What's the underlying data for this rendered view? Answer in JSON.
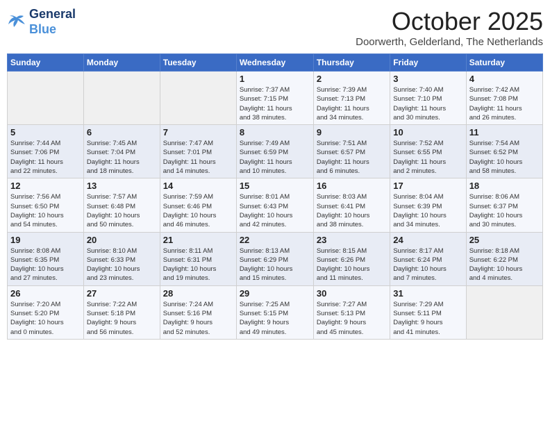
{
  "header": {
    "logo_line1": "General",
    "logo_line2": "Blue",
    "month": "October 2025",
    "location": "Doorwerth, Gelderland, The Netherlands"
  },
  "weekdays": [
    "Sunday",
    "Monday",
    "Tuesday",
    "Wednesday",
    "Thursday",
    "Friday",
    "Saturday"
  ],
  "weeks": [
    [
      {
        "day": "",
        "info": ""
      },
      {
        "day": "",
        "info": ""
      },
      {
        "day": "",
        "info": ""
      },
      {
        "day": "1",
        "info": "Sunrise: 7:37 AM\nSunset: 7:15 PM\nDaylight: 11 hours\nand 38 minutes."
      },
      {
        "day": "2",
        "info": "Sunrise: 7:39 AM\nSunset: 7:13 PM\nDaylight: 11 hours\nand 34 minutes."
      },
      {
        "day": "3",
        "info": "Sunrise: 7:40 AM\nSunset: 7:10 PM\nDaylight: 11 hours\nand 30 minutes."
      },
      {
        "day": "4",
        "info": "Sunrise: 7:42 AM\nSunset: 7:08 PM\nDaylight: 11 hours\nand 26 minutes."
      }
    ],
    [
      {
        "day": "5",
        "info": "Sunrise: 7:44 AM\nSunset: 7:06 PM\nDaylight: 11 hours\nand 22 minutes."
      },
      {
        "day": "6",
        "info": "Sunrise: 7:45 AM\nSunset: 7:04 PM\nDaylight: 11 hours\nand 18 minutes."
      },
      {
        "day": "7",
        "info": "Sunrise: 7:47 AM\nSunset: 7:01 PM\nDaylight: 11 hours\nand 14 minutes."
      },
      {
        "day": "8",
        "info": "Sunrise: 7:49 AM\nSunset: 6:59 PM\nDaylight: 11 hours\nand 10 minutes."
      },
      {
        "day": "9",
        "info": "Sunrise: 7:51 AM\nSunset: 6:57 PM\nDaylight: 11 hours\nand 6 minutes."
      },
      {
        "day": "10",
        "info": "Sunrise: 7:52 AM\nSunset: 6:55 PM\nDaylight: 11 hours\nand 2 minutes."
      },
      {
        "day": "11",
        "info": "Sunrise: 7:54 AM\nSunset: 6:52 PM\nDaylight: 10 hours\nand 58 minutes."
      }
    ],
    [
      {
        "day": "12",
        "info": "Sunrise: 7:56 AM\nSunset: 6:50 PM\nDaylight: 10 hours\nand 54 minutes."
      },
      {
        "day": "13",
        "info": "Sunrise: 7:57 AM\nSunset: 6:48 PM\nDaylight: 10 hours\nand 50 minutes."
      },
      {
        "day": "14",
        "info": "Sunrise: 7:59 AM\nSunset: 6:46 PM\nDaylight: 10 hours\nand 46 minutes."
      },
      {
        "day": "15",
        "info": "Sunrise: 8:01 AM\nSunset: 6:43 PM\nDaylight: 10 hours\nand 42 minutes."
      },
      {
        "day": "16",
        "info": "Sunrise: 8:03 AM\nSunset: 6:41 PM\nDaylight: 10 hours\nand 38 minutes."
      },
      {
        "day": "17",
        "info": "Sunrise: 8:04 AM\nSunset: 6:39 PM\nDaylight: 10 hours\nand 34 minutes."
      },
      {
        "day": "18",
        "info": "Sunrise: 8:06 AM\nSunset: 6:37 PM\nDaylight: 10 hours\nand 30 minutes."
      }
    ],
    [
      {
        "day": "19",
        "info": "Sunrise: 8:08 AM\nSunset: 6:35 PM\nDaylight: 10 hours\nand 27 minutes."
      },
      {
        "day": "20",
        "info": "Sunrise: 8:10 AM\nSunset: 6:33 PM\nDaylight: 10 hours\nand 23 minutes."
      },
      {
        "day": "21",
        "info": "Sunrise: 8:11 AM\nSunset: 6:31 PM\nDaylight: 10 hours\nand 19 minutes."
      },
      {
        "day": "22",
        "info": "Sunrise: 8:13 AM\nSunset: 6:29 PM\nDaylight: 10 hours\nand 15 minutes."
      },
      {
        "day": "23",
        "info": "Sunrise: 8:15 AM\nSunset: 6:26 PM\nDaylight: 10 hours\nand 11 minutes."
      },
      {
        "day": "24",
        "info": "Sunrise: 8:17 AM\nSunset: 6:24 PM\nDaylight: 10 hours\nand 7 minutes."
      },
      {
        "day": "25",
        "info": "Sunrise: 8:18 AM\nSunset: 6:22 PM\nDaylight: 10 hours\nand 4 minutes."
      }
    ],
    [
      {
        "day": "26",
        "info": "Sunrise: 7:20 AM\nSunset: 5:20 PM\nDaylight: 10 hours\nand 0 minutes."
      },
      {
        "day": "27",
        "info": "Sunrise: 7:22 AM\nSunset: 5:18 PM\nDaylight: 9 hours\nand 56 minutes."
      },
      {
        "day": "28",
        "info": "Sunrise: 7:24 AM\nSunset: 5:16 PM\nDaylight: 9 hours\nand 52 minutes."
      },
      {
        "day": "29",
        "info": "Sunrise: 7:25 AM\nSunset: 5:15 PM\nDaylight: 9 hours\nand 49 minutes."
      },
      {
        "day": "30",
        "info": "Sunrise: 7:27 AM\nSunset: 5:13 PM\nDaylight: 9 hours\nand 45 minutes."
      },
      {
        "day": "31",
        "info": "Sunrise: 7:29 AM\nSunset: 5:11 PM\nDaylight: 9 hours\nand 41 minutes."
      },
      {
        "day": "",
        "info": ""
      }
    ]
  ]
}
